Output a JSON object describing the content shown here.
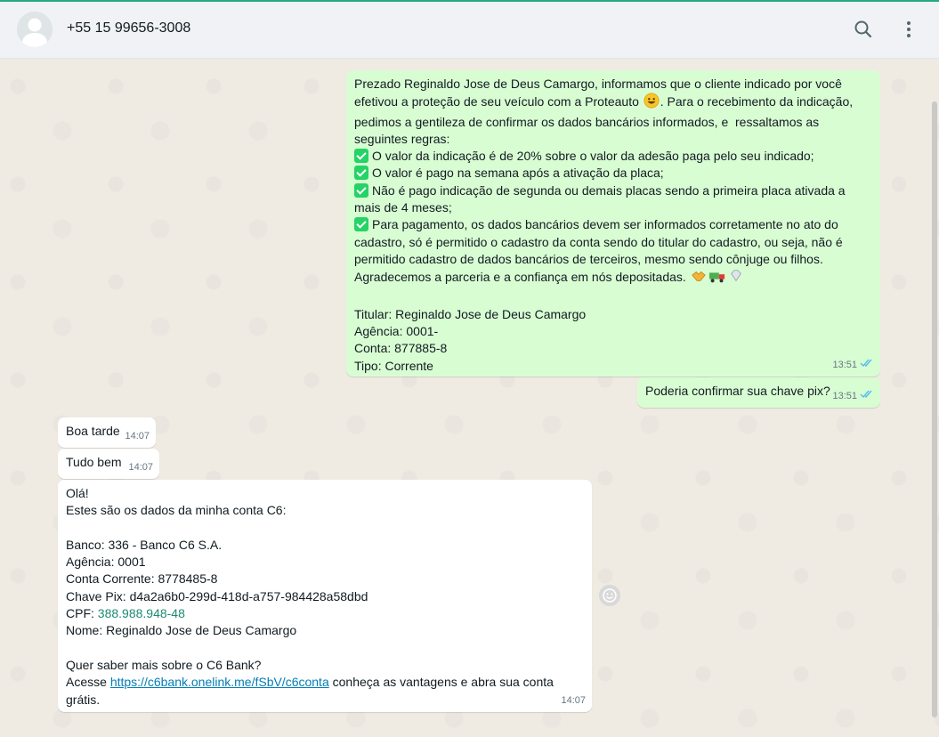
{
  "header": {
    "contact": "+55 15 99656-3008",
    "icons": [
      "search-icon",
      "menu-icon"
    ]
  },
  "colors": {
    "outgoing_bubble": "#d9fdd3",
    "incoming_bubble": "#ffffff",
    "read_ticks": "#53bdeb",
    "link": "#027eb5"
  },
  "messages": {
    "m1": {
      "l01": "Prezado Reginaldo Jose de Deus Camargo, informamos que o cliente indicado por você",
      "l02": "efetivou a proteção de seu veículo com a Proteauto ",
      "l02b": ". Para o recebimento da indicação,",
      "l03": "pedimos a gentileza de confirmar os dados bancários informados, e  ressaltamos as",
      "l04": "seguintes regras:",
      "l05": "O valor da indicação é de 20% sobre o valor da adesão paga pelo seu indicado;",
      "l06": "O valor é pago na semana após a ativação da placa;",
      "l07": "Não é pago indicação de segunda ou demais placas sendo a primeira placa ativada a",
      "l08": "mais de 4 meses;",
      "l09": "Para pagamento, os dados bancários devem ser informados corretamente no ato do",
      "l10": "cadastro, só é permitido o cadastro da conta sendo do titular do cadastro, ou seja, não é",
      "l11": "permitido cadastro de dados bancários de terceiros, mesmo sendo cônjuge ou filhos.",
      "l12": "Agradecemos a parceria e a confiança em nós depositadas. ",
      "l14": "Titular: Reginaldo Jose de Deus Camargo",
      "l15": "Agência: 0001-",
      "l16": "Conta: 877885-8",
      "l17": "Tipo: Corrente",
      "time": "13:51"
    },
    "m2": {
      "text": "Poderia confirmar sua chave pix?",
      "time": "13:51"
    },
    "m3": {
      "text": "Boa tarde",
      "time": "14:07"
    },
    "m4": {
      "text": "Tudo bem",
      "time": "14:07"
    },
    "m5": {
      "l01": "Olá!",
      "l02": "Estes são os dados da minha conta C6:",
      "l04": "Banco: 336 - Banco C6 S.A.",
      "l05": "Agência: 0001",
      "l06": "Conta Corrente: 8778485-8",
      "l07": "Chave Pix: d4a2a6b0-299d-418d-a757-984428a58dbd",
      "l08a": "CPF: ",
      "l08b": "388.988.948-48",
      "l09": "Nome: Reginaldo Jose de Deus Camargo",
      "l11": "Quer saber mais sobre o C6 Bank?",
      "l12a": "Acesse ",
      "l12b": "https://c6bank.onelink.me/fSbV/c6conta",
      "l12c": " conheça as vantagens e abra sua conta",
      "l13": "grátis.",
      "time": "14:07"
    }
  }
}
